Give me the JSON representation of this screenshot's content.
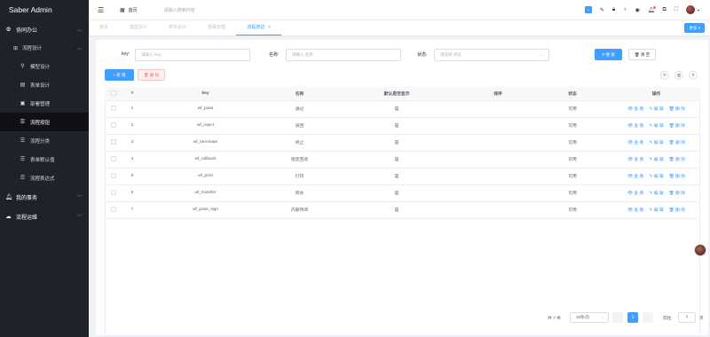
{
  "sidebar": {
    "title": "Saber Admin",
    "groups": [
      {
        "label": "协同办公",
        "icon": "grid-icon"
      },
      {
        "label": "流程设计",
        "icon": "apps-icon"
      }
    ],
    "items": [
      {
        "label": "模型设计",
        "icon": "pin-icon"
      },
      {
        "label": "表单设计",
        "icon": "form-icon"
      },
      {
        "label": "部署管理",
        "icon": "deploy-icon"
      },
      {
        "label": "流程按钮",
        "icon": "list-icon"
      },
      {
        "label": "流程分类",
        "icon": "list-icon"
      },
      {
        "label": "表单默认值",
        "icon": "list-icon"
      },
      {
        "label": "流程表达式",
        "icon": "list-icon"
      }
    ],
    "bottom_groups": [
      {
        "label": "我的事务",
        "icon": "bell-icon"
      },
      {
        "label": "流程运维",
        "icon": "cloud-icon"
      }
    ]
  },
  "header": {
    "home_label": "首页",
    "search_placeholder": "请输入搜索内容"
  },
  "tabs": [
    {
      "label": "首页"
    },
    {
      "label": "模型设计"
    },
    {
      "label": "表单设计"
    },
    {
      "label": "部署管理"
    },
    {
      "label": "流程按钮"
    }
  ],
  "more_label": "更多",
  "filters": {
    "key_label": "key:",
    "key_placeholder": "请输入 Key",
    "name_label": "名称:",
    "name_placeholder": "请输入 名称",
    "status_label": "状态:",
    "status_placeholder": "请选择 状态",
    "search_label": "搜 索",
    "clear_label": "清 空"
  },
  "actions": {
    "add_label": "+ 新 增",
    "delete_label": "删 除"
  },
  "table": {
    "headers": [
      "#",
      "key",
      "名称",
      "默认是否显示",
      "排序",
      "状态",
      "操作"
    ],
    "rows": [
      {
        "index": "1",
        "key": "wf_pass",
        "name": "通过",
        "default": "是",
        "sort": "",
        "status": "可用"
      },
      {
        "index": "2",
        "key": "wf_reject",
        "name": "驳回",
        "default": "是",
        "sort": "",
        "status": "可用"
      },
      {
        "index": "3",
        "key": "wf_terminate",
        "name": "终止",
        "default": "是",
        "sort": "",
        "status": "可用"
      },
      {
        "index": "4",
        "key": "wf_rollback",
        "name": "指定回退",
        "default": "是",
        "sort": "",
        "status": "可用"
      },
      {
        "index": "5",
        "key": "wf_print",
        "name": "打印",
        "default": "是",
        "sort": "",
        "status": "可用"
      },
      {
        "index": "6",
        "key": "wf_transfer",
        "name": "转办",
        "default": "是",
        "sort": "",
        "status": "可用"
      },
      {
        "index": "7",
        "key": "wf_pass_sign",
        "name": "内部传阅",
        "default": "是",
        "sort": "",
        "status": "可用"
      }
    ],
    "op_view": "查 看",
    "op_edit": "编 辑",
    "op_delete": "删 除"
  },
  "pagination": {
    "total": "共 7 条",
    "page_size": "10条/页",
    "current": "1",
    "goto_label": "前往",
    "goto_value": "1",
    "goto_unit": "页"
  },
  "colors": {
    "primary": "#409eff",
    "sidebar_bg": "#20222a",
    "danger": "#f56c6c"
  }
}
